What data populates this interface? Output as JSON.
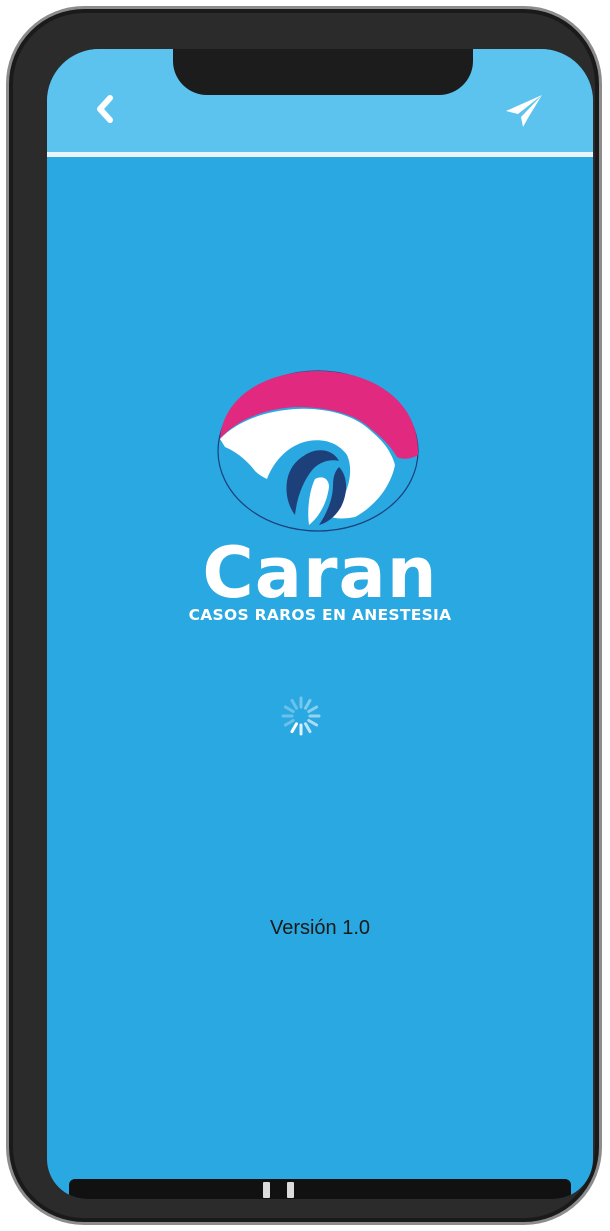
{
  "app": {
    "name": "Caran",
    "tagline": "CASOS RAROS EN ANESTESIA",
    "version_label": "Versión 1.0"
  },
  "toolbar": {
    "back_icon": "chevron-left-icon",
    "send_icon": "paper-plane-icon"
  },
  "loading": {
    "indicator": "spinner-icon"
  },
  "colors": {
    "background": "#2aa8e1",
    "top_bar": "#5cc3ee",
    "logo_magenta": "#e0297f",
    "logo_navy": "#1d3f7a",
    "text_white": "#ffffff",
    "version_text": "#1a1a1a"
  }
}
